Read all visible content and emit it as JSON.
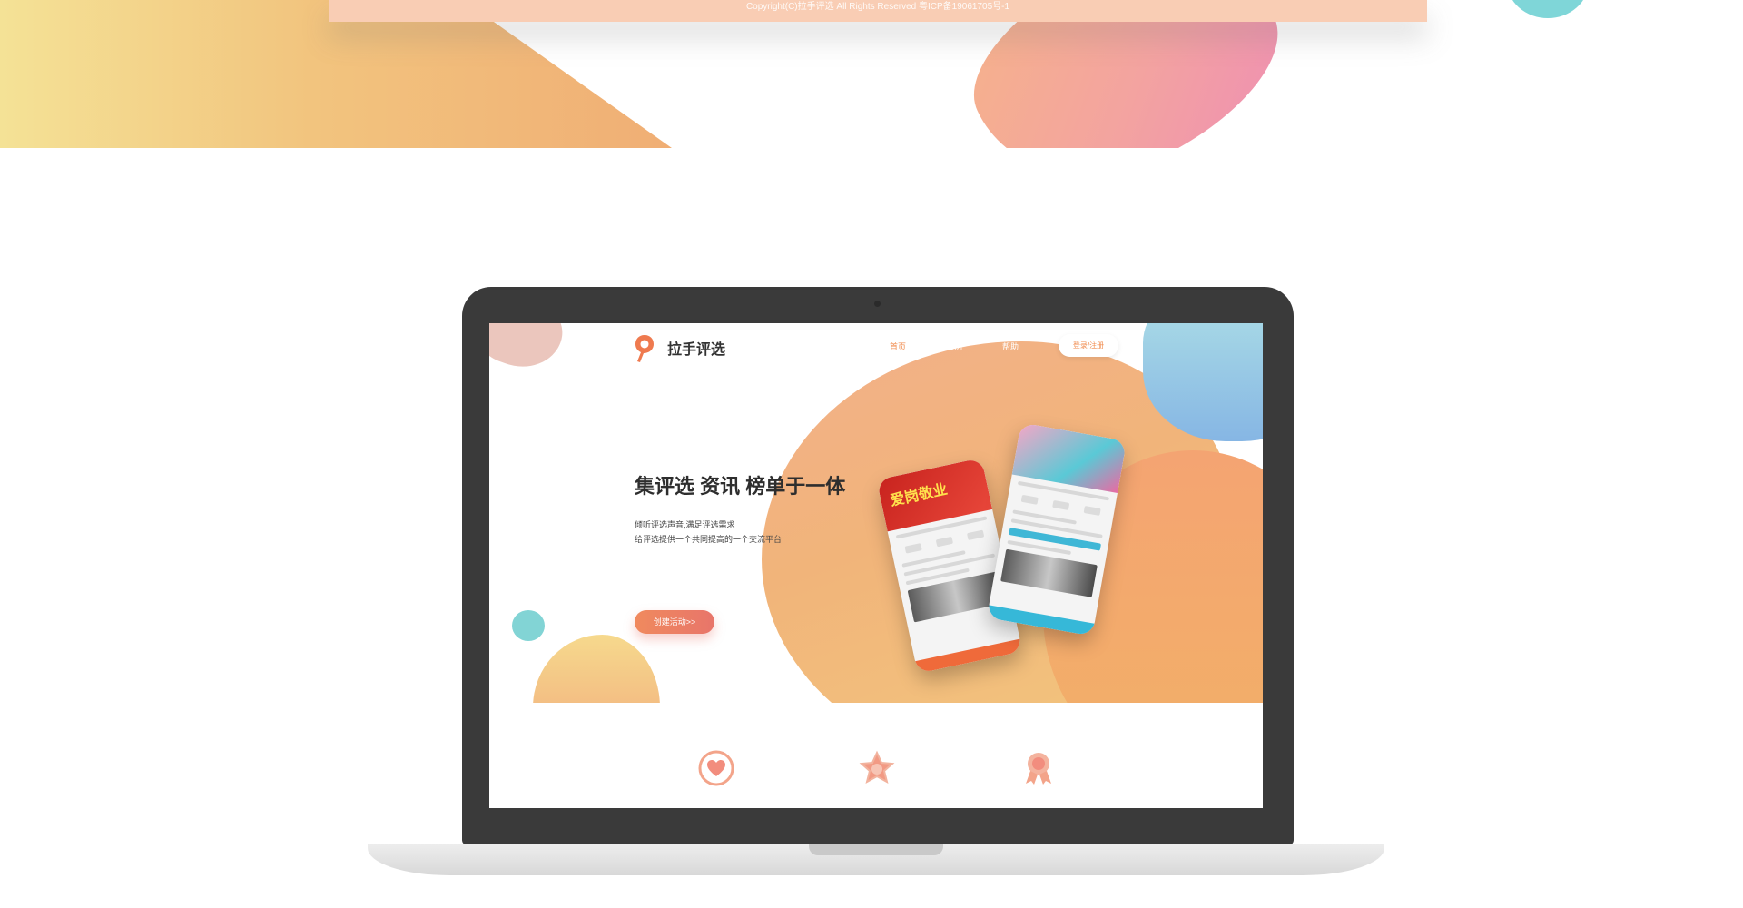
{
  "top_section": {
    "copyright": "Copyright(C)拉手评选 All Rights Reserved 粤ICP备19061705号-1"
  },
  "site": {
    "logo_text": "拉手评选",
    "nav": {
      "home": "首页",
      "case": "案例",
      "help": "帮助",
      "login": "登录/注册"
    },
    "hero": {
      "title": "集评选 资讯 榜单于一体",
      "subtitle_line1": "倾听评选声音,满足评选需求",
      "subtitle_line2": "给评选提供一个共同提高的一个交流平台",
      "cta": "创建活动>>"
    },
    "phones": {
      "left_banner": "爱岗敬业"
    },
    "features": [
      "heart-icon",
      "star-icon",
      "ribbon-icon"
    ]
  },
  "colors": {
    "accent": "#f08a4b",
    "cta_start": "#f08a5e",
    "cta_end": "#e8756a",
    "laptop_frame": "#3a3a3a"
  }
}
